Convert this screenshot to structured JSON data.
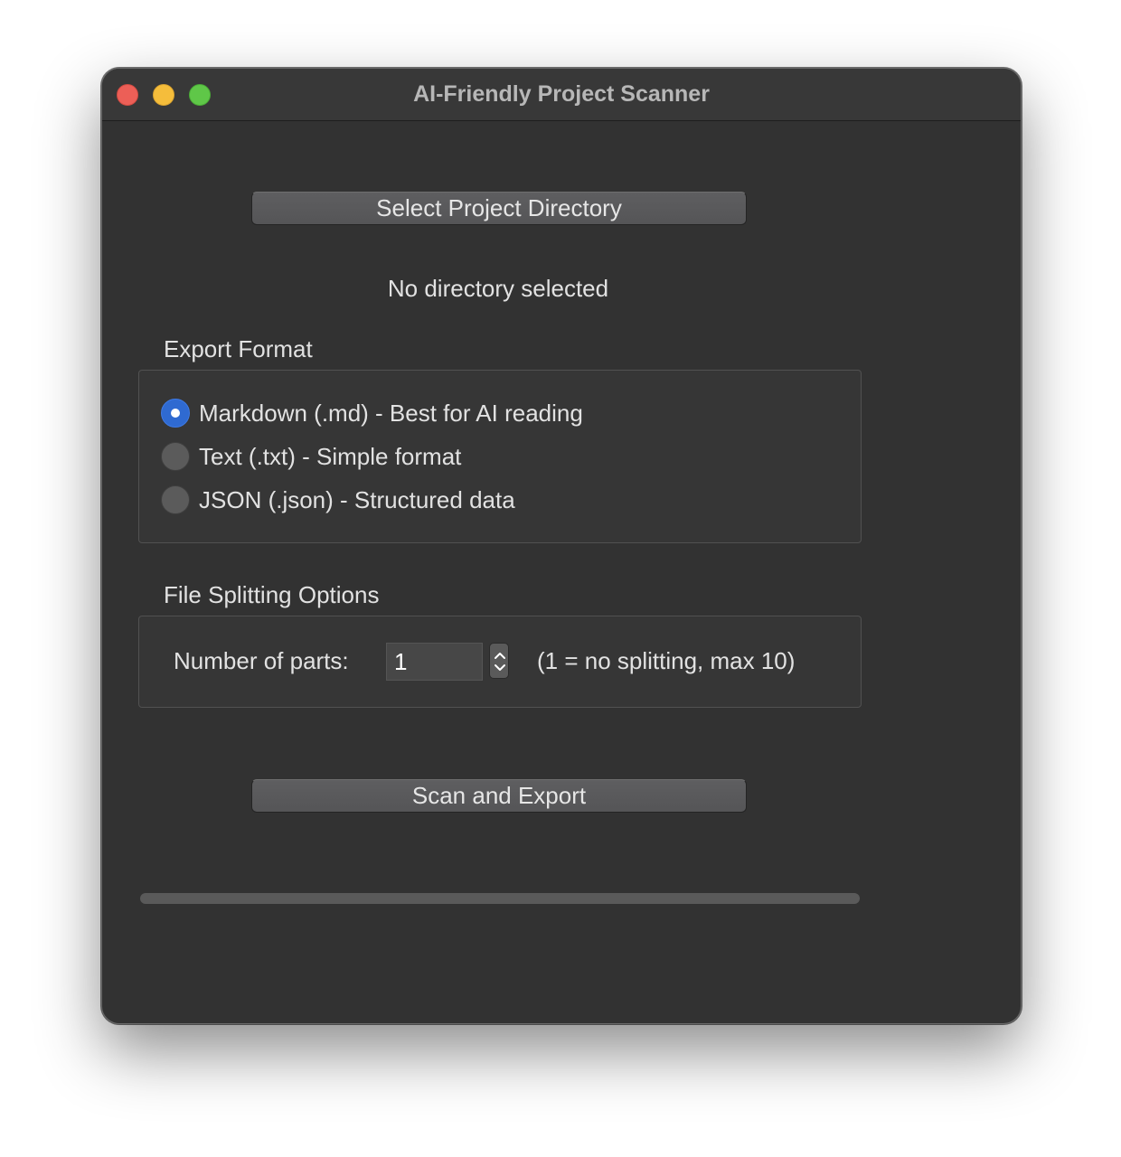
{
  "window": {
    "title": "AI-Friendly Project Scanner"
  },
  "directory": {
    "select_button_label": "Select Project Directory",
    "status_text": "No directory selected"
  },
  "export_format": {
    "group_title": "Export Format",
    "options": [
      {
        "label": "Markdown (.md) - Best for AI reading",
        "checked": true
      },
      {
        "label": "Text (.txt) - Simple format",
        "checked": false
      },
      {
        "label": "JSON (.json) - Structured data",
        "checked": false
      }
    ]
  },
  "file_splitting": {
    "group_title": "File Splitting Options",
    "parts_label": "Number of parts:",
    "parts_value": "1",
    "parts_hint": "(1 = no splitting, max 10)"
  },
  "actions": {
    "scan_button_label": "Scan and Export"
  },
  "progress": {
    "value_percent": 0
  },
  "colors": {
    "accent": "#2f6ad1",
    "window_bg": "#323232",
    "close": "#ec5f57",
    "minimize": "#f5bd3b",
    "maximize": "#5fc748"
  }
}
